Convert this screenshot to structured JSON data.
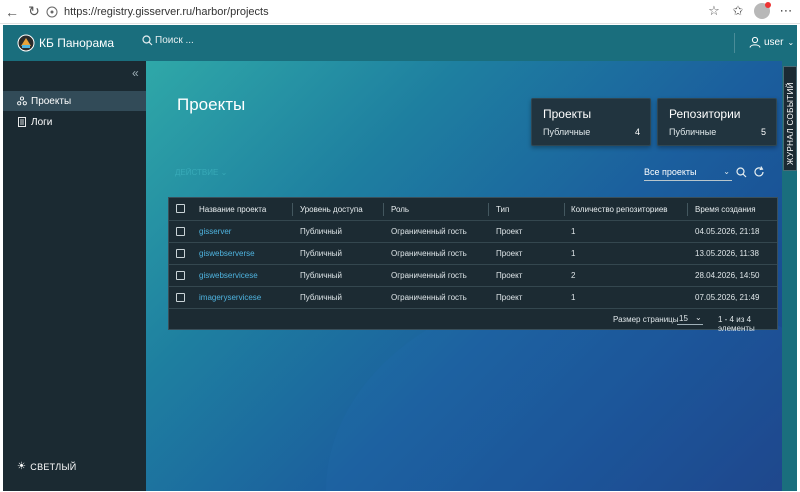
{
  "browser": {
    "url": "https://registry.gisserver.ru/harbor/projects"
  },
  "header": {
    "brand": "КБ Панорама",
    "search_label": "Поиск ...",
    "user": "user"
  },
  "sidebar": {
    "items": [
      {
        "label": "Проекты",
        "icon": "projects-icon",
        "active": true
      },
      {
        "label": "Логи",
        "icon": "logs-icon",
        "active": false
      }
    ],
    "theme_label": "СВЕТЛЫЙ"
  },
  "main": {
    "title": "Проекты",
    "cards": [
      {
        "title": "Проекты",
        "sub": "Публичные",
        "value": "4"
      },
      {
        "title": "Репозитории",
        "sub": "Публичные",
        "value": "5"
      }
    ],
    "action_label": "ДЕЙСТВИЕ",
    "filter_value": "Все проекты"
  },
  "table": {
    "columns": [
      "Название проекта",
      "Уровень доступа",
      "Роль",
      "Тип",
      "Количество репозиториев",
      "Время создания"
    ],
    "rows": [
      {
        "name": "gisserver",
        "access": "Публичный",
        "role": "Ограниченный гость",
        "type": "Проект",
        "repos": "1",
        "created": "04.05.2026, 21:18"
      },
      {
        "name": "giswebserverse",
        "access": "Публичный",
        "role": "Ограниченный гость",
        "type": "Проект",
        "repos": "1",
        "created": "13.05.2026, 11:38"
      },
      {
        "name": "giswebservicese",
        "access": "Публичный",
        "role": "Ограниченный гость",
        "type": "Проект",
        "repos": "2",
        "created": "28.04.2026, 14:50"
      },
      {
        "name": "imageryservicese",
        "access": "Публичный",
        "role": "Ограниченный гость",
        "type": "Проект",
        "repos": "1",
        "created": "07.05.2026, 21:49"
      }
    ],
    "footer": {
      "page_size_label": "Размер страницы",
      "page_size": "15",
      "info": "1 - 4 из 4 элементы"
    }
  },
  "rail": {
    "label": "ЖУРНАЛ СОБЫТИЙ"
  },
  "colors": {
    "header": "#1a6e7d",
    "sidebar": "#1b2a32",
    "link": "#4fb4e0"
  }
}
